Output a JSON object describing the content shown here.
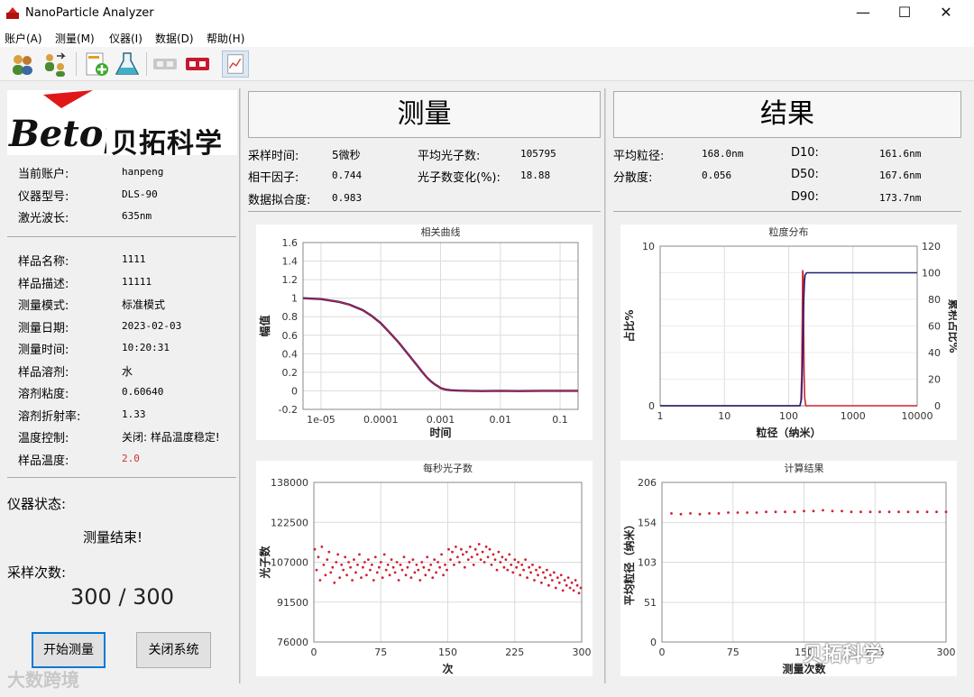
{
  "window": {
    "title": "NanoParticle Analyzer",
    "minimize": "—",
    "maximize": "☐",
    "close": "✕"
  },
  "menu": [
    "账户(A)",
    "测量(M)",
    "仪器(I)",
    "数据(D)",
    "帮助(H)"
  ],
  "toolbar": [
    {
      "name": "users-icon"
    },
    {
      "name": "switch-user-icon"
    },
    {
      "name": "new-sop-icon"
    },
    {
      "name": "flask-icon"
    },
    {
      "name": "disconnect-icon"
    },
    {
      "name": "connect-icon"
    },
    {
      "name": "report-icon"
    }
  ],
  "logo": {
    "brand_cn": "贝拓科学",
    "mark": "Betop"
  },
  "account": [
    {
      "label": "当前账户:",
      "value": "hanpeng"
    },
    {
      "label": "仪器型号:",
      "value": "DLS-90"
    },
    {
      "label": "激光波长:",
      "value": "635nm"
    }
  ],
  "sample": [
    {
      "label": "样品名称:",
      "value": "1111"
    },
    {
      "label": "样品描述:",
      "value": "11111"
    },
    {
      "label": "测量模式:",
      "value": "标准模式"
    },
    {
      "label": "测量日期:",
      "value": "2023-02-03"
    },
    {
      "label": "测量时间:",
      "value": "10:20:31"
    },
    {
      "label": "样品溶剂:",
      "value": "水"
    },
    {
      "label": "溶剂粘度:",
      "value": "0.60640"
    },
    {
      "label": "溶剂折射率:",
      "value": "1.33"
    },
    {
      "label": "温度控制:",
      "value": "关闭: 样品温度稳定!"
    },
    {
      "label": "样品温度:",
      "value": "2.0"
    }
  ],
  "colors": {
    "accent": "#0078d7",
    "temp_value": "#d03030",
    "series_red": "#d02030",
    "series_blue": "#20207a"
  },
  "status": {
    "label": "仪器状态:",
    "value": "测量结束!"
  },
  "count": {
    "label": "采样次数:",
    "value": "300 / 300"
  },
  "buttons": {
    "start": "开始测量",
    "close": "关闭系统"
  },
  "measure": {
    "header": "测量",
    "fields": [
      {
        "label": "采样时间:",
        "value": "5微秒"
      },
      {
        "label": "平均光子数:",
        "value": "105795"
      },
      {
        "label": "相干因子:",
        "value": "0.744"
      },
      {
        "label": "光子数变化(%):",
        "value": "18.88"
      },
      {
        "label": "数据拟合度:",
        "value": "0.983"
      }
    ]
  },
  "results": {
    "header": "结果",
    "fields": [
      {
        "label": "平均粒径:",
        "value": "168.0nm"
      },
      {
        "label": "D10:",
        "value": "161.6nm"
      },
      {
        "label": "分散度:",
        "value": "0.056"
      },
      {
        "label": "D50:",
        "value": "167.6nm"
      },
      {
        "label": "D90:",
        "value": "173.7nm"
      }
    ]
  },
  "watermarks": {
    "left": "大数跨境",
    "right": "贝拓科学"
  },
  "chart_data": [
    {
      "type": "line",
      "title": "相关曲线",
      "xlabel": "时间",
      "ylabel": "幅值",
      "xscale": "log",
      "xlim": [
        5e-06,
        0.2
      ],
      "ylim": [
        -0.2,
        1.6
      ],
      "xticks": [
        "1e-05",
        "0.0001",
        "0.001",
        "0.01",
        "0.1"
      ],
      "xtick_values": [
        1e-05,
        0.0001,
        0.001,
        0.01,
        0.1
      ],
      "yticks": [
        "1.6",
        "1.4",
        "1.2",
        "1",
        "0.8",
        "0.6",
        "0.4",
        "0.2",
        "0",
        "-0.2"
      ],
      "ytick_values": [
        1.6,
        1.4,
        1.2,
        1,
        0.8,
        0.6,
        0.4,
        0.2,
        0,
        -0.2
      ],
      "grid": true,
      "series": [
        {
          "x": [
            5e-06,
            1e-05,
            2e-05,
            3e-05,
            5e-05,
            7e-05,
            0.0001,
            0.00015,
            0.0002,
            0.0003,
            0.0004,
            0.0005,
            0.0006,
            0.0007,
            0.0008,
            0.0009,
            0.001,
            0.0012,
            0.0015,
            0.002,
            0.003,
            0.005,
            0.01,
            0.02,
            0.05,
            0.1,
            0.2
          ],
          "y": [
            1.0,
            0.99,
            0.96,
            0.93,
            0.87,
            0.81,
            0.73,
            0.61,
            0.52,
            0.38,
            0.28,
            0.2,
            0.14,
            0.1,
            0.07,
            0.05,
            0.03,
            0.015,
            0.006,
            0.002,
            0.0,
            -0.002,
            0.0,
            -0.002,
            0.0,
            0.0,
            0.0
          ]
        }
      ]
    },
    {
      "type": "line",
      "title": "粒度分布",
      "xlabel": "粒径（纳米）",
      "ylabel": "占比%",
      "y2label": "累积占比%",
      "xscale": "log",
      "xlim": [
        1,
        10000
      ],
      "ylim": [
        0,
        10
      ],
      "y2lim": [
        0,
        120
      ],
      "xticks": [
        "1",
        "10",
        "100",
        "1000",
        "10000"
      ],
      "xtick_values": [
        1,
        10,
        100,
        1000,
        10000
      ],
      "yticks": [
        "10",
        "0"
      ],
      "ytick_values": [
        10,
        0
      ],
      "y2ticks": [
        "120",
        "100",
        "80",
        "60",
        "40",
        "20",
        "0"
      ],
      "y2tick_values": [
        120,
        100,
        80,
        60,
        40,
        20,
        0
      ],
      "grid": true,
      "series": [
        {
          "x": [
            1,
            150,
            155,
            160,
            163,
            165,
            168,
            171,
            174,
            178,
            185,
            10000
          ],
          "y": [
            0,
            0,
            0.3,
            2,
            5.5,
            8.5,
            8.2,
            5,
            2,
            0.5,
            0,
            0
          ]
        },
        {
          "x": [
            1,
            150,
            158,
            162,
            165,
            168,
            172,
            176,
            180,
            190,
            10000
          ],
          "y": [
            0,
            0,
            5,
            20,
            40,
            60,
            80,
            93,
            98,
            100,
            100
          ],
          "axis": "y2"
        }
      ]
    },
    {
      "type": "scatter",
      "title": "每秒光子数",
      "xlabel": "次",
      "ylabel": "光子数",
      "xlim": [
        0,
        300
      ],
      "ylim": [
        76000,
        138000
      ],
      "xticks": [
        "0",
        "75",
        "150",
        "225",
        "300"
      ],
      "xtick_values": [
        0,
        75,
        150,
        225,
        300
      ],
      "yticks": [
        "138000",
        "122500",
        "107000",
        "91500",
        "76000"
      ],
      "ytick_values": [
        138000,
        122500,
        107000,
        91500,
        76000
      ],
      "grid": true,
      "series": [
        {
          "x": [
            1,
            3,
            5,
            7,
            9,
            11,
            13,
            15,
            17,
            19,
            21,
            23,
            25,
            27,
            29,
            31,
            33,
            35,
            37,
            39,
            41,
            43,
            45,
            47,
            49,
            51,
            53,
            55,
            57,
            59,
            61,
            63,
            65,
            67,
            69,
            71,
            73,
            75,
            77,
            79,
            81,
            83,
            85,
            87,
            89,
            91,
            93,
            95,
            97,
            99,
            101,
            103,
            105,
            107,
            109,
            111,
            113,
            115,
            117,
            119,
            121,
            123,
            125,
            127,
            129,
            131,
            133,
            135,
            137,
            139,
            141,
            143,
            145,
            147,
            149,
            151,
            153,
            155,
            157,
            159,
            161,
            163,
            165,
            167,
            169,
            171,
            173,
            175,
            177,
            179,
            181,
            183,
            185,
            187,
            189,
            191,
            193,
            195,
            197,
            199,
            201,
            203,
            205,
            207,
            209,
            211,
            213,
            215,
            217,
            219,
            221,
            223,
            225,
            227,
            229,
            231,
            233,
            235,
            237,
            239,
            241,
            243,
            245,
            247,
            249,
            251,
            253,
            255,
            257,
            259,
            261,
            263,
            265,
            267,
            269,
            271,
            273,
            275,
            277,
            279,
            281,
            283,
            285,
            287,
            289,
            291,
            293,
            295,
            297,
            299
          ],
          "y": [
            112000,
            104000,
            109000,
            100000,
            113000,
            106000,
            102000,
            108000,
            111000,
            103000,
            105000,
            99000,
            107000,
            110000,
            101000,
            106000,
            104000,
            109000,
            102000,
            107000,
            105000,
            100000,
            108000,
            103000,
            106000,
            110000,
            101000,
            105000,
            107000,
            102000,
            108000,
            104000,
            106000,
            100000,
            109000,
            103000,
            105000,
            107000,
            101000,
            110000,
            104000,
            106000,
            102000,
            108000,
            105000,
            103000,
            107000,
            100000,
            106000,
            104000,
            109000,
            102000,
            105000,
            107000,
            101000,
            108000,
            103000,
            106000,
            104000,
            100000,
            107000,
            105000,
            102000,
            109000,
            104000,
            106000,
            101000,
            108000,
            103000,
            107000,
            105000,
            110000,
            102000,
            106000,
            104000,
            112000,
            108000,
            111000,
            106000,
            113000,
            109000,
            107000,
            112000,
            110000,
            105000,
            111000,
            108000,
            113000,
            109000,
            106000,
            112000,
            110000,
            114000,
            108000,
            111000,
            107000,
            113000,
            109000,
            112000,
            106000,
            110000,
            108000,
            104000,
            111000,
            107000,
            109000,
            105000,
            108000,
            104000,
            110000,
            106000,
            103000,
            108000,
            105000,
            107000,
            102000,
            106000,
            104000,
            108000,
            101000,
            105000,
            103000,
            106000,
            100000,
            104000,
            102000,
            105000,
            99000,
            103000,
            101000,
            104000,
            98000,
            102000,
            100000,
            103000,
            97000,
            101000,
            99000,
            102000,
            96000,
            100000,
            98000,
            101000,
            97000,
            99000,
            96000,
            100000,
            98000,
            95000,
            97000
          ]
        }
      ]
    },
    {
      "type": "scatter",
      "title": "计算结果",
      "xlabel": "测量次数",
      "ylabel": "平均粒径（纳米）",
      "xlim": [
        0,
        300
      ],
      "ylim": [
        0,
        206
      ],
      "xticks": [
        "0",
        "75",
        "150",
        "225",
        "300"
      ],
      "xtick_values": [
        0,
        75,
        150,
        225,
        300
      ],
      "yticks": [
        "206",
        "154",
        "103",
        "51",
        "0"
      ],
      "ytick_values": [
        206,
        154,
        103,
        51,
        0
      ],
      "grid": true,
      "series": [
        {
          "x": [
            10,
            20,
            30,
            40,
            50,
            60,
            70,
            80,
            90,
            100,
            110,
            120,
            130,
            140,
            150,
            160,
            170,
            180,
            190,
            200,
            210,
            220,
            230,
            240,
            250,
            260,
            270,
            280,
            290,
            300
          ],
          "y": [
            166,
            165,
            166,
            165,
            166,
            166,
            167,
            167,
            167,
            167,
            168,
            168,
            168,
            168,
            169,
            169,
            170,
            169,
            169,
            168,
            168,
            168,
            168,
            168,
            168,
            168,
            168,
            168,
            168,
            168
          ]
        }
      ]
    }
  ]
}
